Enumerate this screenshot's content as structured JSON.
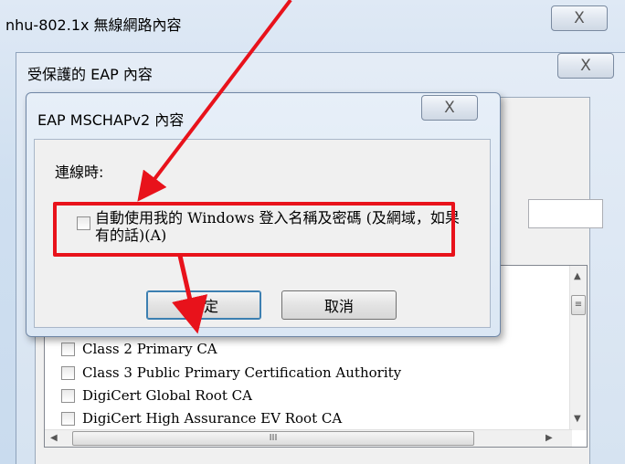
{
  "outer_window": {
    "title": "nhu-802.1x 無線網路內容",
    "close_label": "X"
  },
  "peap_window": {
    "title": "受保護的 EAP 內容",
    "close_label": "X"
  },
  "dialog": {
    "title": "EAP MSCHAPv2 內容",
    "close_label": "X",
    "connect_label": "連線時:",
    "auto_use_label": "自動使用我的 Windows 登入名稱及密碼 (及網域，如果有的話)(A)",
    "auto_use_checked": false,
    "ok_label": "確定",
    "cancel_label": "取消"
  },
  "ca_list": {
    "items": [
      "Class 2 Primary CA",
      "Class 3 Public Primary Certification Authority",
      "DigiCert Global Root CA",
      "DigiCert High Assurance EV Root CA"
    ],
    "scroll_thumb_glyph": "≡",
    "hscroll_thumb_glyph": "III"
  },
  "annotation": {
    "color": "#e8121b"
  }
}
